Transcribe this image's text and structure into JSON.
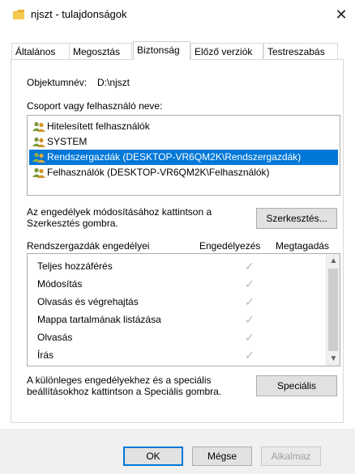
{
  "window": {
    "title": "njszt - tulajdonságok",
    "close_glyph": "✕",
    "icon": "folder-icon"
  },
  "tabs": [
    {
      "label": "Általános"
    },
    {
      "label": "Megosztás"
    },
    {
      "label": "Biztonság"
    },
    {
      "label": "Előző verziók"
    },
    {
      "label": "Testreszabás"
    }
  ],
  "object": {
    "label": "Objektumnév:",
    "value": "D:\\njszt"
  },
  "group_list": {
    "label": "Csoport vagy felhasználó neve:",
    "items": [
      {
        "label": "Hitelesített felhasználók",
        "icon": "users-icon"
      },
      {
        "label": "SYSTEM",
        "icon": "users-icon"
      },
      {
        "label": "Rendszergazdák (DESKTOP-VR6QM2K\\Rendszergazdák)",
        "icon": "users-icon",
        "selected": true
      },
      {
        "label": "Felhasználók (DESKTOP-VR6QM2K\\Felhasználók)",
        "icon": "users-icon"
      }
    ]
  },
  "edit": {
    "text_line1": "Az engedélyek módosításához kattintson a",
    "text_line2": "Szerkesztés gombra.",
    "button": "Szerkesztés..."
  },
  "permissions": {
    "header": "Rendszergazdák engedélyei",
    "allow_header": "Engedélyezés",
    "deny_header": "Megtagadás",
    "rows": [
      {
        "name": "Teljes hozzáférés",
        "allow": "✓"
      },
      {
        "name": "Módosítás",
        "allow": "✓"
      },
      {
        "name": "Olvasás és végrehajtás",
        "allow": "✓"
      },
      {
        "name": "Mappa tartalmának listázása",
        "allow": "✓"
      },
      {
        "name": "Olvasás",
        "allow": "✓"
      },
      {
        "name": "Írás",
        "allow": "✓"
      }
    ],
    "scroll_up": "▲",
    "scroll_down": "▼"
  },
  "special": {
    "text_line1": "A különleges engedélyekhez és a speciális",
    "text_line2": "beállításokhoz kattintson a Speciális gombra.",
    "button": "Speciális"
  },
  "footer": {
    "ok": "OK",
    "cancel": "Mégse",
    "apply": "Alkalmaz"
  },
  "colors": {
    "selection": "#0078d7",
    "folder": "#e8b23a"
  }
}
